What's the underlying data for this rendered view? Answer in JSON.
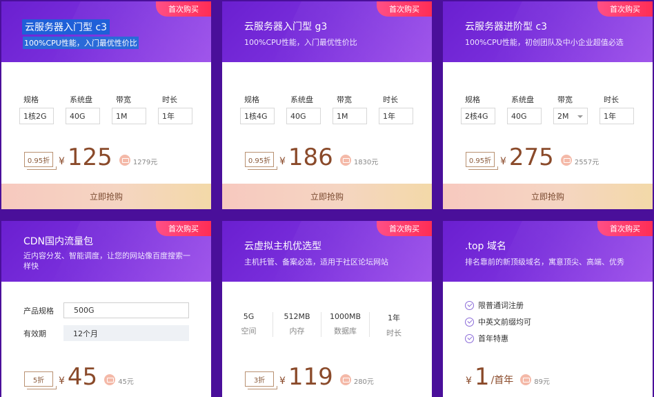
{
  "badge": "首次购买",
  "buy_label": "立即抢购",
  "cards": [
    {
      "title": "云服务器入门型 c3",
      "subtitle": "100%CPU性能，入门最优性价比",
      "specs": [
        {
          "label": "规格",
          "value": "1核2G"
        },
        {
          "label": "系统盘",
          "value": "40G"
        },
        {
          "label": "带宽",
          "value": "1M"
        },
        {
          "label": "时长",
          "value": "1年"
        }
      ],
      "discount": "0.95折",
      "currency": "¥",
      "price": "125",
      "original": "1279元"
    },
    {
      "title": "云服务器入门型 g3",
      "subtitle": "100%CPU性能，入门最优性价比",
      "specs": [
        {
          "label": "规格",
          "value": "1核4G"
        },
        {
          "label": "系统盘",
          "value": "40G"
        },
        {
          "label": "带宽",
          "value": "1M"
        },
        {
          "label": "时长",
          "value": "1年"
        }
      ],
      "discount": "0.95折",
      "currency": "¥",
      "price": "186",
      "original": "1830元"
    },
    {
      "title": "云服务器进阶型 c3",
      "subtitle": "100%CPU性能，初创团队及中小企业超值必选",
      "specs": [
        {
          "label": "规格",
          "value": "2核4G"
        },
        {
          "label": "系统盘",
          "value": "40G"
        },
        {
          "label": "带宽",
          "value": "2M"
        },
        {
          "label": "时长",
          "value": "1年"
        }
      ],
      "discount": "0.95折",
      "currency": "¥",
      "price": "275",
      "original": "2557元"
    },
    {
      "title": "CDN国内流量包",
      "subtitle": "近内容分发、智能调度，让您的网站像百度搜索一样快",
      "form": [
        {
          "label": "产品规格",
          "value": "500G"
        },
        {
          "label": "有效期",
          "value": "12个月"
        }
      ],
      "discount": "5折",
      "currency": "¥",
      "price": "45",
      "original": "45元"
    },
    {
      "title": "云虚拟主机优选型",
      "subtitle": "主机托管、备案必选，适用于社区论坛网站",
      "stats": [
        {
          "value": "5G",
          "label": "空间"
        },
        {
          "value": "512MB",
          "label": "内存"
        },
        {
          "value": "1000MB",
          "label": "数据库"
        },
        {
          "value": "1年",
          "label": "时长"
        }
      ],
      "discount": "3折",
      "currency": "¥",
      "price": "119",
      "original": "280元"
    },
    {
      "title": ".top 域名",
      "subtitle": "排名靠前的新顶级域名，寓意顶尖、高端、优秀",
      "features": [
        "限普通词注册",
        "中英文前缀均可",
        "首年特惠"
      ],
      "currency": "¥",
      "price": "1",
      "unit": "/首年",
      "original": "89元"
    }
  ]
}
